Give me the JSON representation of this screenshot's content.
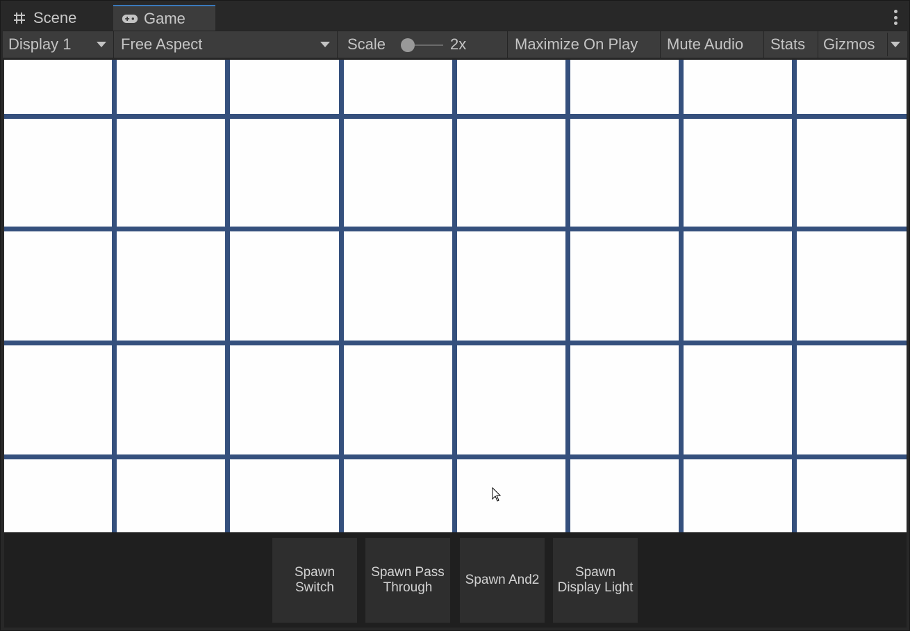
{
  "tabs": [
    {
      "label": "Scene",
      "icon": "grid-hash-icon"
    },
    {
      "label": "Game",
      "icon": "gamepad-icon"
    }
  ],
  "toolbar": {
    "display_label": "Display 1",
    "aspect_label": "Free Aspect",
    "scale_label": "Scale",
    "scale_value": "2x",
    "maximize_label": "Maximize On Play",
    "mute_label": "Mute Audio",
    "stats_label": "Stats",
    "gizmos_label": "Gizmos"
  },
  "game": {
    "grid_color": "#35507d",
    "background": "#fefefe"
  },
  "buttons": [
    {
      "label": "Spawn\nSwitch"
    },
    {
      "label": "Spawn Pass\nThrough"
    },
    {
      "label": "Spawn And2"
    },
    {
      "label": "Spawn\nDisplay Light"
    }
  ]
}
